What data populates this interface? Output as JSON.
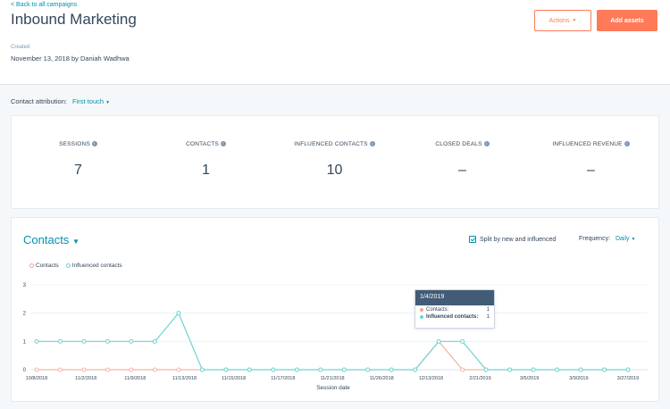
{
  "header": {
    "back_link": "< Back to all campaigns",
    "title": "Inbound Marketing",
    "created_label": "Created",
    "created_value": "November 13, 2018 by Daniah Wadhwa",
    "actions_label": "Actions",
    "add_assets_label": "Add assets"
  },
  "attribution": {
    "label": "Contact attribution:",
    "value": "First touch"
  },
  "stats": [
    {
      "label": "SESSIONS",
      "value": "7"
    },
    {
      "label": "CONTACTS",
      "value": "1"
    },
    {
      "label": "INFLUENCED CONTACTS",
      "value": "10"
    },
    {
      "label": "CLOSED DEALS",
      "value": "–"
    },
    {
      "label": "INFLUENCED REVENUE",
      "value": "–"
    }
  ],
  "chart_panel": {
    "title": "Contacts",
    "split_label": "Split by new and influenced",
    "frequency_label": "Frequency:",
    "frequency_value": "Daily"
  },
  "tooltip": {
    "date": "1/4/2019",
    "rows": [
      {
        "label": "Contacts:",
        "value": "1"
      },
      {
        "label": "Influenced contacts:",
        "value": "1"
      }
    ]
  },
  "colors": {
    "contacts": "#f2a58e",
    "influenced": "#6cd3d3",
    "accent": "#0091ae",
    "orange": "#ff7a59"
  },
  "chart_data": {
    "type": "line",
    "xlabel": "Session date",
    "ylabel": "",
    "ylim": [
      0,
      3
    ],
    "yticks": [
      "0",
      "1",
      "2",
      "3"
    ],
    "xtick_labels": [
      "10/8/2018",
      "11/2/2018",
      "11/9/2018",
      "11/13/2018",
      "11/15/2018",
      "11/17/2018",
      "11/21/2018",
      "11/26/2018",
      "12/13/2018",
      "2/21/2019",
      "3/5/2019",
      "3/9/2019",
      "3/27/2019"
    ],
    "series": [
      {
        "name": "Contacts",
        "values": [
          0,
          0,
          0,
          0,
          0,
          0,
          0,
          0,
          0,
          0,
          0,
          0,
          0,
          0,
          0,
          0,
          0,
          0,
          0,
          0,
          0,
          0,
          0,
          0,
          0,
          0
        ]
      },
      {
        "name": "Influenced contacts",
        "values": [
          1,
          1,
          1,
          1,
          1,
          1,
          2,
          0,
          0,
          0,
          0,
          0,
          0,
          0,
          0,
          0,
          0,
          1,
          1,
          0,
          0,
          0,
          0,
          0,
          0,
          0
        ]
      }
    ],
    "contacts_peak": {
      "index": 17,
      "value": 1
    },
    "grid": true
  }
}
